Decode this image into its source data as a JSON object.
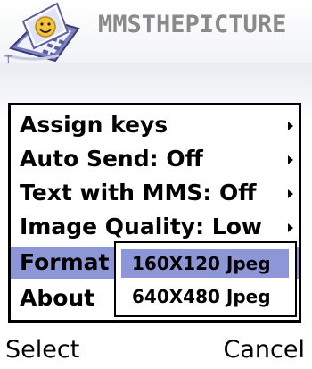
{
  "app": {
    "title": "MMSTHEPICTURE",
    "corner_indicator": "⊤"
  },
  "menu": {
    "items": [
      {
        "label": "Assign keys",
        "has_submenu": true
      },
      {
        "label": "Auto Send: Off",
        "has_submenu": true
      },
      {
        "label": "Text with MMS: Off",
        "has_submenu": true
      },
      {
        "label": "Image Quality: Low",
        "has_submenu": true
      },
      {
        "label": "Format",
        "has_submenu": true,
        "selected": true
      },
      {
        "label": "About",
        "has_submenu": false
      }
    ]
  },
  "submenu": {
    "items": [
      {
        "label": "160X120 Jpeg",
        "selected": true
      },
      {
        "label": "640X480 Jpeg",
        "selected": false
      }
    ]
  },
  "softkeys": {
    "left": "Select",
    "right": "Cancel"
  },
  "colors": {
    "highlight": "#8d97d8",
    "title_text": "#8a8a8a"
  }
}
